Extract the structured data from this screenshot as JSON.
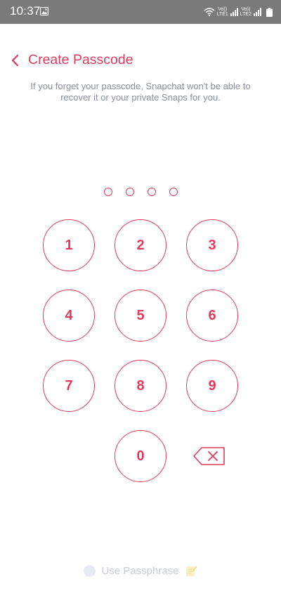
{
  "status_bar": {
    "time": "10:37",
    "sim1_top": "Vo))",
    "sim1_bottom": "LTE1",
    "sim2_top": "Vo))",
    "sim2_bottom": "LTE2"
  },
  "header": {
    "title": "Create Passcode"
  },
  "subtitle": "If you forget your passcode, Snapchat won't be able to recover it or your private Snaps for you.",
  "passcode": {
    "length": 4,
    "entered": 0
  },
  "keypad": {
    "k1": "1",
    "k2": "2",
    "k3": "3",
    "k4": "4",
    "k5": "5",
    "k6": "6",
    "k7": "7",
    "k8": "8",
    "k9": "9",
    "k0": "0"
  },
  "footer": {
    "passphrase_label": "Use Passphrase"
  },
  "colors": {
    "accent": "#e33a5b",
    "status_bar": "#7a7a7a",
    "subtitle": "#8a8f99",
    "muted": "#c9ced6"
  },
  "icons": {
    "back": "chevron-left-icon",
    "backspace": "backspace-icon",
    "passphrase": "notepad-emoji-icon"
  }
}
